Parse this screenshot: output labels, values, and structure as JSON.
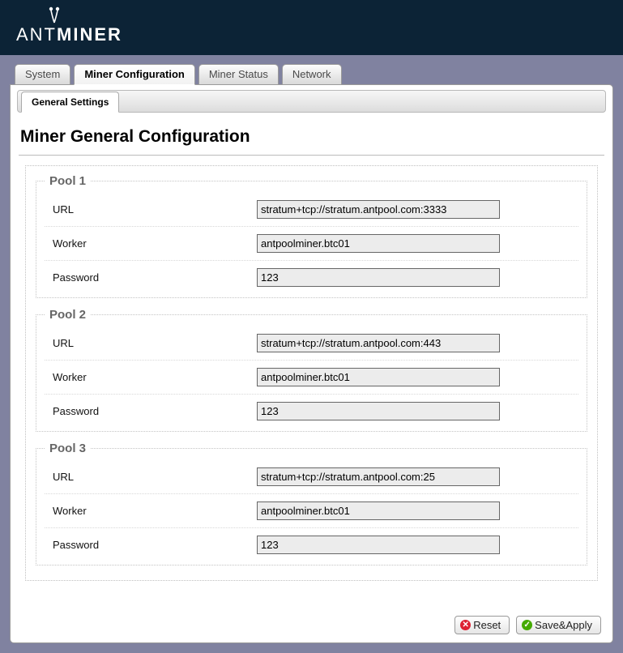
{
  "brand": {
    "prefix": "ANT",
    "suffix": "MINER"
  },
  "tabs": {
    "system": "System",
    "miner_config": "Miner Configuration",
    "miner_status": "Miner Status",
    "network": "Network"
  },
  "sub_tabs": {
    "general": "General Settings"
  },
  "page_title": "Miner General Configuration",
  "labels": {
    "url": "URL",
    "worker": "Worker",
    "password": "Password"
  },
  "pools": [
    {
      "legend": "Pool 1",
      "url": "stratum+tcp://stratum.antpool.com:3333",
      "worker": "antpoolminer.btc01",
      "password": "123"
    },
    {
      "legend": "Pool 2",
      "url": "stratum+tcp://stratum.antpool.com:443",
      "worker": "antpoolminer.btc01",
      "password": "123"
    },
    {
      "legend": "Pool 3",
      "url": "stratum+tcp://stratum.antpool.com:25",
      "worker": "antpoolminer.btc01",
      "password": "123"
    }
  ],
  "buttons": {
    "reset": "Reset",
    "save_apply": "Save&Apply"
  }
}
